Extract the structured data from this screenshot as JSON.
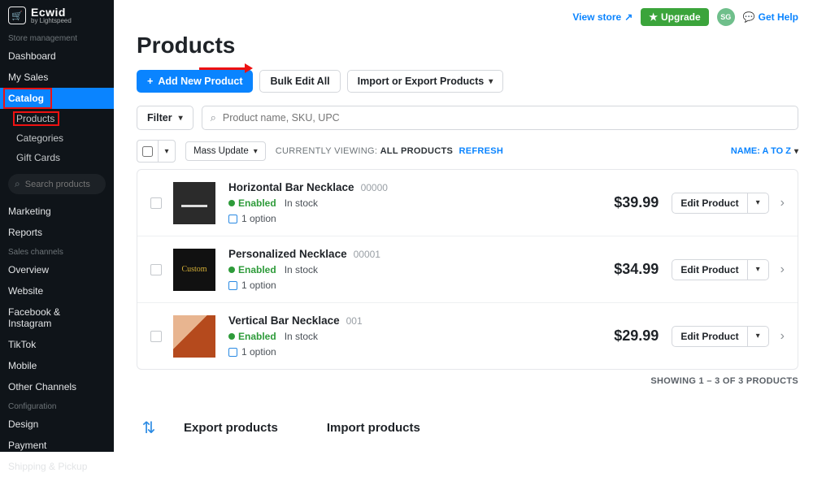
{
  "brand": {
    "name": "Ecwid",
    "sub": "by Lightspeed"
  },
  "sidebar": {
    "section_store": "Store management",
    "items_store": [
      "Dashboard",
      "My Sales",
      "Catalog"
    ],
    "catalog_subs": [
      "Products",
      "Categories",
      "Gift Cards"
    ],
    "search_placeholder": "Search products",
    "items_mid": [
      "Marketing",
      "Reports"
    ],
    "section_channels": "Sales channels",
    "items_channels": [
      "Overview",
      "Website",
      "Facebook & Instagram",
      "TikTok",
      "Mobile",
      "Other Channels"
    ],
    "section_config": "Configuration",
    "items_config": [
      "Design",
      "Payment",
      "Shipping & Pickup"
    ]
  },
  "topbar": {
    "view_store": "View store",
    "upgrade": "Upgrade",
    "avatar": "SG",
    "help": "Get Help"
  },
  "page": {
    "title": "Products"
  },
  "toolbar": {
    "add": "Add New Product",
    "bulk": "Bulk Edit All",
    "impexp": "Import or Export Products"
  },
  "filter": {
    "label": "Filter"
  },
  "search": {
    "placeholder": "Product name, SKU, UPC"
  },
  "bulkbar": {
    "mass": "Mass Update",
    "viewing_label": "CURRENTLY VIEWING:",
    "viewing_value": "ALL PRODUCTS",
    "refresh": "REFRESH",
    "sort": "NAME: A TO Z"
  },
  "products": [
    {
      "name": "Horizontal Bar Necklace",
      "sku": "00000",
      "status": "Enabled",
      "stock": "In stock",
      "options": "1 option",
      "price": "$39.99",
      "edit": "Edit Product",
      "img": "img1"
    },
    {
      "name": "Personalized Necklace",
      "sku": "00001",
      "status": "Enabled",
      "stock": "In stock",
      "options": "1 option",
      "price": "$34.99",
      "edit": "Edit Product",
      "img": "img2",
      "imgtext": "Custom"
    },
    {
      "name": "Vertical Bar Necklace",
      "sku": "001",
      "status": "Enabled",
      "stock": "In stock",
      "options": "1 option",
      "price": "$29.99",
      "edit": "Edit Product",
      "img": "img3"
    }
  ],
  "showing": "SHOWING 1 – 3 OF 3 PRODUCTS",
  "bottom": {
    "export": "Export products",
    "import": "Import products"
  }
}
